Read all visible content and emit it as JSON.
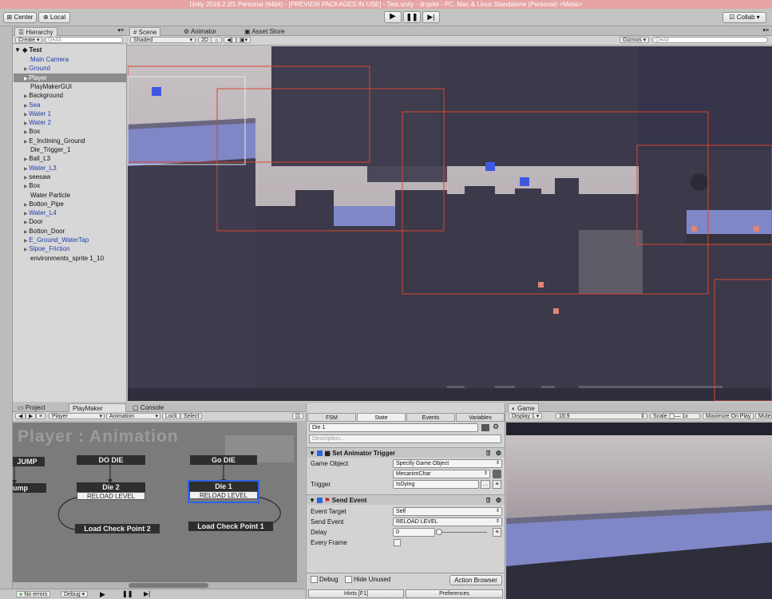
{
  "window": {
    "title": "Unity 2018.2.2f1 Personal (64bit) - [PREVIEW PACKAGES IN USE] - Test.unity - droplet - PC, Mac & Linux Standalone (Personal) <Metal>"
  },
  "toolbar": {
    "center_label": "Center",
    "local_label": "Local",
    "collab_label": "Collab"
  },
  "hierarchy": {
    "tab_label": "Hierarchy",
    "create_label": "Create",
    "search_placeholder": "Q▾All",
    "scene_name": "Test",
    "items": [
      {
        "label": "Main Camera",
        "blue": true,
        "arrow": false
      },
      {
        "label": "Ground",
        "blue": true,
        "arrow": true
      },
      {
        "label": "Player",
        "blue": true,
        "arrow": true,
        "selected": true
      },
      {
        "label": "PlayMakerGUI",
        "blue": false,
        "arrow": false
      },
      {
        "label": "Background",
        "blue": false,
        "arrow": true
      },
      {
        "label": "Sea",
        "blue": true,
        "arrow": true
      },
      {
        "label": "Water 1",
        "blue": true,
        "arrow": true
      },
      {
        "label": "Water 2",
        "blue": true,
        "arrow": true
      },
      {
        "label": "Box",
        "blue": false,
        "arrow": true
      },
      {
        "label": "E_Inclining_Ground",
        "blue": false,
        "arrow": true
      },
      {
        "label": "Die_Trigger_1",
        "blue": false,
        "arrow": false
      },
      {
        "label": "Ball_L3",
        "blue": false,
        "arrow": true
      },
      {
        "label": "Water_L3",
        "blue": true,
        "arrow": true
      },
      {
        "label": "seesaw",
        "blue": false,
        "arrow": true
      },
      {
        "label": "Box",
        "blue": false,
        "arrow": true
      },
      {
        "label": "Water Particle",
        "blue": false,
        "arrow": false
      },
      {
        "label": "Botton_Pipe",
        "blue": false,
        "arrow": true
      },
      {
        "label": "Water_L4",
        "blue": true,
        "arrow": true
      },
      {
        "label": "Door",
        "blue": false,
        "arrow": true
      },
      {
        "label": "Botton_Door",
        "blue": false,
        "arrow": true
      },
      {
        "label": "E_Ground_WaterTap",
        "blue": true,
        "arrow": true
      },
      {
        "label": "Slpoe_Friction",
        "blue": true,
        "arrow": true
      },
      {
        "label": "environments_sprite 1_10",
        "blue": false,
        "arrow": false
      }
    ]
  },
  "scene_tabs": {
    "scene": "Scene",
    "animator": "Animator",
    "asset_store": "Asset Store"
  },
  "scene_toolbar": {
    "shaded": "Shaded",
    "mode_2d": "2D",
    "gizmos": "Gizmos",
    "search_placeholder": "Q▾All"
  },
  "bottom_tabs": {
    "project": "Project",
    "playmaker": "PlayMaker",
    "console": "Console"
  },
  "playmaker": {
    "object": "Player",
    "fsm": "Animation",
    "lock": "Lock",
    "select": "Select",
    "title": "Player : Animation",
    "events": {
      "jump": "JUMP",
      "do_die": "DO DIE",
      "go_die": "Go DIE"
    },
    "states": {
      "jump": "ump",
      "die2": "Die 2",
      "die2_event": "RELOAD LEVEL",
      "die1": "Die 1",
      "die1_event": "RELOAD LEVEL",
      "load2": "Load Check Point 2",
      "load1": "Load Check Point 1"
    }
  },
  "fsm_inspector": {
    "tabs": [
      "FSM",
      "State",
      "Events",
      "Variables"
    ],
    "state_name": "Die 1",
    "description_placeholder": "Description...",
    "action1": {
      "title": "Set Animator Trigger",
      "game_object_label": "Game Object",
      "game_object_value": "Specify Game Object",
      "object_value": "MecanimChar",
      "trigger_label": "Trigger",
      "trigger_value": "IsDying"
    },
    "action2": {
      "title": "Send Event",
      "event_target_label": "Event Target",
      "event_target_value": "Self",
      "send_event_label": "Send Event",
      "send_event_value": "RELOAD LEVEL",
      "delay_label": "Delay",
      "delay_value": "0",
      "every_frame_label": "Every Frame"
    },
    "debug_label": "Debug",
    "hide_unused_label": "Hide Unused",
    "action_browser_label": "Action Browser",
    "hints_label": "Hints [F1]",
    "preferences_label": "Preferences"
  },
  "game": {
    "tab_label": "Game",
    "display": "Display 1",
    "aspect": "16:9",
    "scale_label": "Scale",
    "scale_value": "1x",
    "maximize": "Maximize On Play",
    "mute": "Mute"
  },
  "statusbar": {
    "errors": "No errors",
    "debug": "Debug"
  }
}
